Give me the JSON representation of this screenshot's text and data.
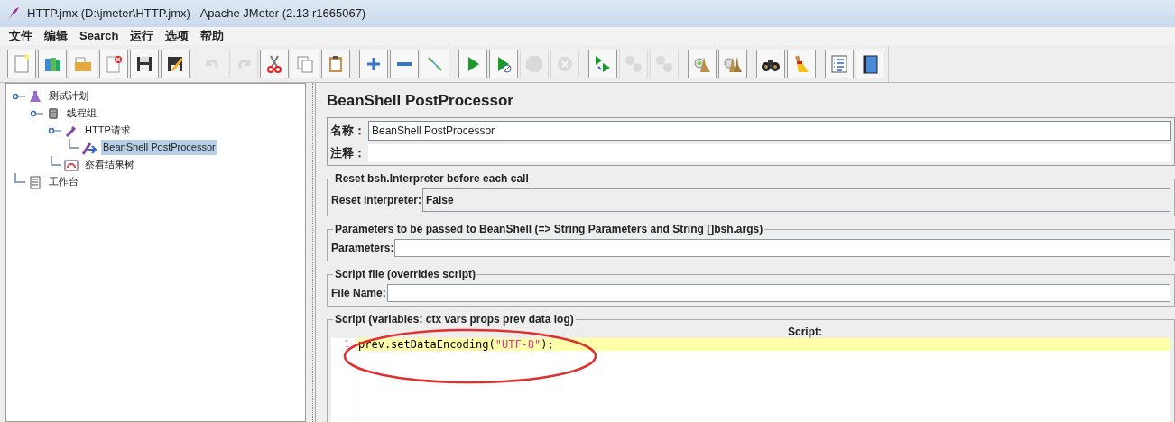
{
  "window": {
    "title": "HTTP.jmx (D:\\jmeter\\HTTP.jmx) - Apache JMeter (2.13 r1665067)"
  },
  "menu": [
    "文件",
    "编辑",
    "Search",
    "运行",
    "选项",
    "帮助"
  ],
  "toolbar": [
    [
      {
        "kind": "new",
        "disabled": false
      },
      {
        "kind": "templates",
        "disabled": false
      },
      {
        "kind": "open",
        "disabled": false
      },
      {
        "kind": "close",
        "disabled": false
      },
      {
        "kind": "save",
        "disabled": false
      },
      {
        "kind": "save-as",
        "disabled": false
      }
    ],
    [
      {
        "kind": "undo",
        "disabled": true
      },
      {
        "kind": "redo",
        "disabled": true
      },
      {
        "kind": "cut",
        "disabled": false
      },
      {
        "kind": "copy",
        "disabled": false
      },
      {
        "kind": "paste",
        "disabled": false
      }
    ],
    [
      {
        "kind": "expand",
        "disabled": false
      },
      {
        "kind": "collapse",
        "disabled": false
      },
      {
        "kind": "toggle",
        "disabled": false
      }
    ],
    [
      {
        "kind": "start",
        "disabled": false
      },
      {
        "kind": "start-no-pause",
        "disabled": false
      },
      {
        "kind": "stop",
        "disabled": true
      },
      {
        "kind": "shutdown",
        "disabled": true
      }
    ],
    [
      {
        "kind": "remote-start",
        "disabled": false
      },
      {
        "kind": "remote-stop",
        "disabled": true
      },
      {
        "kind": "remote-exit",
        "disabled": true
      }
    ],
    [
      {
        "kind": "clear",
        "disabled": false
      },
      {
        "kind": "clear-all",
        "disabled": false
      }
    ],
    [
      {
        "kind": "search",
        "disabled": false
      },
      {
        "kind": "reset-search",
        "disabled": false
      }
    ],
    [
      {
        "kind": "functions",
        "disabled": false
      },
      {
        "kind": "help",
        "disabled": false
      }
    ]
  ],
  "tree": [
    {
      "label": "测试计划",
      "kind": "plan",
      "selected": false,
      "children": [
        {
          "label": "线程组",
          "kind": "threads",
          "selected": false,
          "children": [
            {
              "label": "HTTP请求",
              "kind": "sampler",
              "selected": false,
              "children": [
                {
                  "label": "BeanShell PostProcessor",
                  "kind": "postprocessor",
                  "selected": true
                }
              ]
            },
            {
              "label": "察看结果树",
              "kind": "listener",
              "selected": false
            }
          ]
        }
      ]
    },
    {
      "label": "工作台",
      "kind": "workbench",
      "selected": false
    }
  ],
  "panel": {
    "title": "BeanShell PostProcessor",
    "name_label": "名称：",
    "name_value": "BeanShell PostProcessor",
    "comment_label": "注释：",
    "groups": [
      {
        "title": "Reset bsh.Interpreter before each call",
        "kind": "combo",
        "label": "Reset Interpreter:",
        "value": "False"
      },
      {
        "title": "Parameters to be passed to BeanShell (=> String Parameters and String []bsh.args)",
        "kind": "field",
        "label": "Parameters:"
      },
      {
        "title": "Script file (overrides script)",
        "kind": "field",
        "label": "File Name:"
      }
    ],
    "script": {
      "title": "Script (variables: ctx vars props prev data log)",
      "header": "Script:",
      "lines": [
        {
          "number": "1",
          "current": true,
          "tokens": [
            {
              "kind": "plain",
              "text": "prev.setDataEncoding("
            },
            {
              "kind": "string",
              "text": "\"UTF-8\""
            },
            {
              "kind": "plain",
              "text": ");"
            }
          ]
        }
      ]
    }
  },
  "annotations": [
    {
      "kind": "ellipse",
      "color": "#e03030"
    }
  ]
}
